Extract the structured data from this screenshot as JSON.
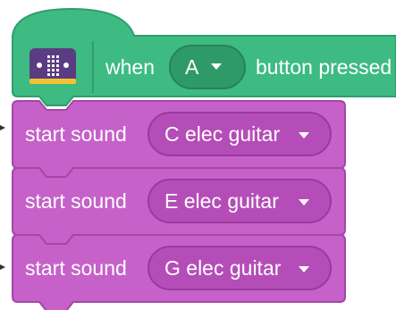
{
  "colors": {
    "hat_fill": "#3dbb82",
    "hat_stroke": "#2f9e6b",
    "hat_dropdown": "#2e9a68",
    "hat_dropdown_stroke": "#258457",
    "stack_fill": "#c661c9",
    "stack_stroke": "#a447a7",
    "stack_dropdown": "#b54db8",
    "stack_dropdown_stroke": "#993a9c",
    "icon_bg": "#5a3c82",
    "icon_led": "#ffffff",
    "icon_edge": "#f3c332",
    "text": "#ffffff"
  },
  "hat": {
    "icon": "microbit-icon",
    "prefix": "when",
    "dropdown_value": "A",
    "suffix": "button pressed"
  },
  "blocks": [
    {
      "label": "start sound",
      "value": "C elec guitar"
    },
    {
      "label": "start sound",
      "value": "E elec guitar"
    },
    {
      "label": "start sound",
      "value": "G elec guitar"
    }
  ],
  "dropdown_arrow": "caret-down-icon"
}
